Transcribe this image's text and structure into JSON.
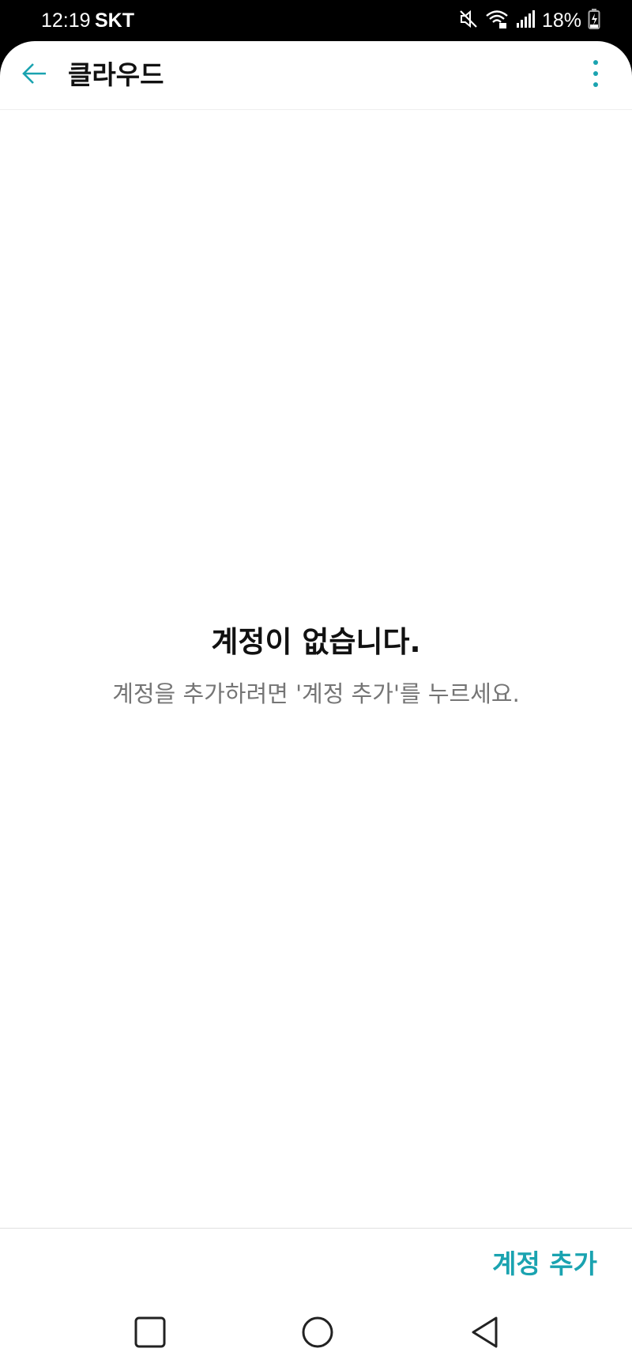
{
  "status_bar": {
    "time": "12:19",
    "carrier": "SKT",
    "battery": "18%",
    "icons": [
      "mute-icon",
      "wifi-icon",
      "signal-icon",
      "battery-charging-icon"
    ]
  },
  "app_bar": {
    "title": "클라우드",
    "back_icon": "back-arrow-icon",
    "more_icon": "more-vert-icon"
  },
  "empty_state": {
    "title": "계정이 없습니다.",
    "description": "계정을 추가하려면 '계정 추가'를 누르세요."
  },
  "actions": {
    "add_account_label": "계정 추가"
  },
  "nav_bar": {
    "icons": [
      "recents-icon",
      "home-icon",
      "nav-back-icon"
    ]
  },
  "colors": {
    "accent": "#1aa3b0",
    "title_text": "#111111",
    "secondary_text": "#757575"
  }
}
